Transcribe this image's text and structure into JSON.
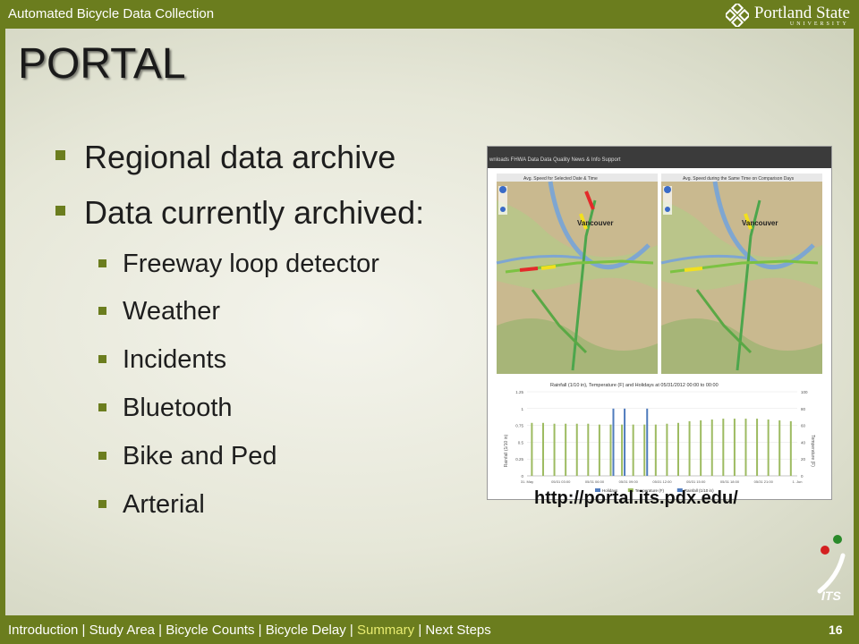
{
  "header": {
    "title": "Automated Bicycle Data Collection",
    "logo_name": "Portland State",
    "logo_sub": "UNIVERSITY"
  },
  "slide": {
    "title": "PORTAL",
    "bullets": [
      "Regional data archive",
      "Data currently archived:"
    ],
    "sub_bullets": [
      "Freeway loop detector",
      "Weather",
      "Incidents",
      "Bluetooth",
      "Bike and Ped",
      "Arterial"
    ],
    "url": "http://portal.its.pdx.edu/"
  },
  "screenshot": {
    "nav": "wnloads   FHWA Data   Data Quality   News & Info   Support",
    "map_left_title": "Avg. Speed for Selected Date & Time",
    "map_right_title": "Avg. Speed during the Same Time on Comparison Days",
    "city_label": "Vancouver",
    "chart_title": "Rainfall (1/10 in), Temperature (F) and Holidays at   05/31/2012 00:00 to 00:00",
    "left_axis_label": "Rainfall (1/10 in)",
    "right_axis_label": "Temperature (F)",
    "left_ticks": [
      "1.25",
      "1",
      "0.75",
      "0.5",
      "0.25",
      "0"
    ],
    "right_ticks": [
      "100",
      "80",
      "60",
      "40",
      "20",
      "0"
    ],
    "x_ticks": [
      "31. May",
      "05/31 03:00",
      "05/31 06:00",
      "05/31 09:00",
      "05/31 12:00",
      "05/31 15:00",
      "05/31 18:00",
      "05/31 21:00",
      "1. Jun"
    ],
    "legend": [
      "Holidays",
      "Temperature (F)",
      "Rainfall (1/10 in)"
    ]
  },
  "footer": {
    "nav": [
      {
        "label": "Introduction",
        "active": false
      },
      {
        "label": "Study Area",
        "active": false
      },
      {
        "label": "Bicycle Counts",
        "active": false
      },
      {
        "label": "Bicycle Delay",
        "active": false
      },
      {
        "label": "Summary",
        "active": true
      },
      {
        "label": "Next Steps",
        "active": false
      }
    ],
    "page_number": "16"
  },
  "colors": {
    "accent": "#6b7d1e",
    "nav_active": "#e8ec70",
    "temp_bar": "#9dbb61",
    "rain_bar": "#4f7bbd"
  }
}
